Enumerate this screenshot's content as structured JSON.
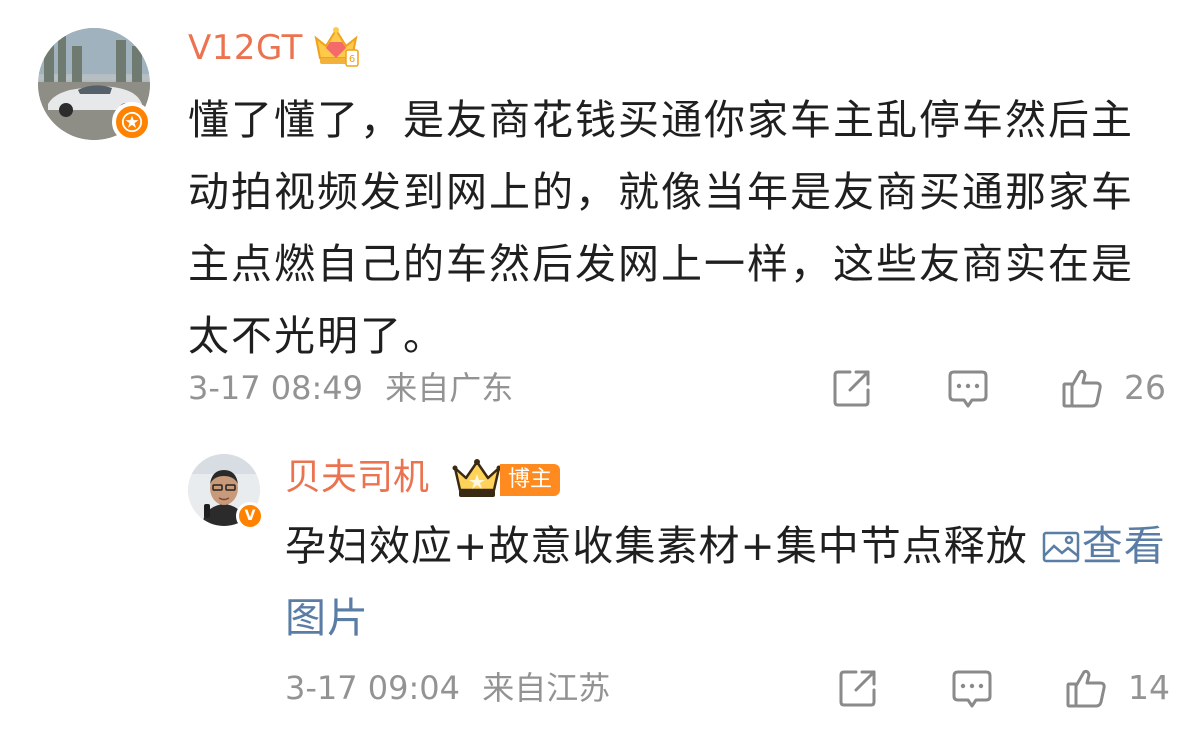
{
  "comments": [
    {
      "username": "V12GT",
      "body": "懂了懂了，是友商花钱买通你家车主乱停车然后主动拍视频发到网上的，就像当年是友商买通那家车主点燃自己的车然后发网上一样，这些友商实在是太不光明了。",
      "timestamp": "3-17 08:49",
      "location": "来自广东",
      "like_count": "26",
      "icons": {
        "share": "share-icon",
        "comment": "comment-icon",
        "like": "like-icon",
        "badge": "star-badge-icon",
        "vip": "crown-icon"
      }
    },
    {
      "username": "贝夫司机",
      "tag": "博主",
      "body": "孕妇效应+故意收集素材+集中节点释放",
      "image_link": "查看图片",
      "timestamp": "3-17 09:04",
      "location": "来自江苏",
      "like_count": "14",
      "badge_letter": "V",
      "icons": {
        "share": "share-icon",
        "comment": "comment-icon",
        "like": "like-icon",
        "badge": "verified-v-icon",
        "vip": "crown-icon",
        "image": "image-icon"
      }
    }
  ],
  "colors": {
    "username": "#eb7350",
    "badge": "#ff8200",
    "link": "#5a7da5",
    "meta": "#939393"
  }
}
